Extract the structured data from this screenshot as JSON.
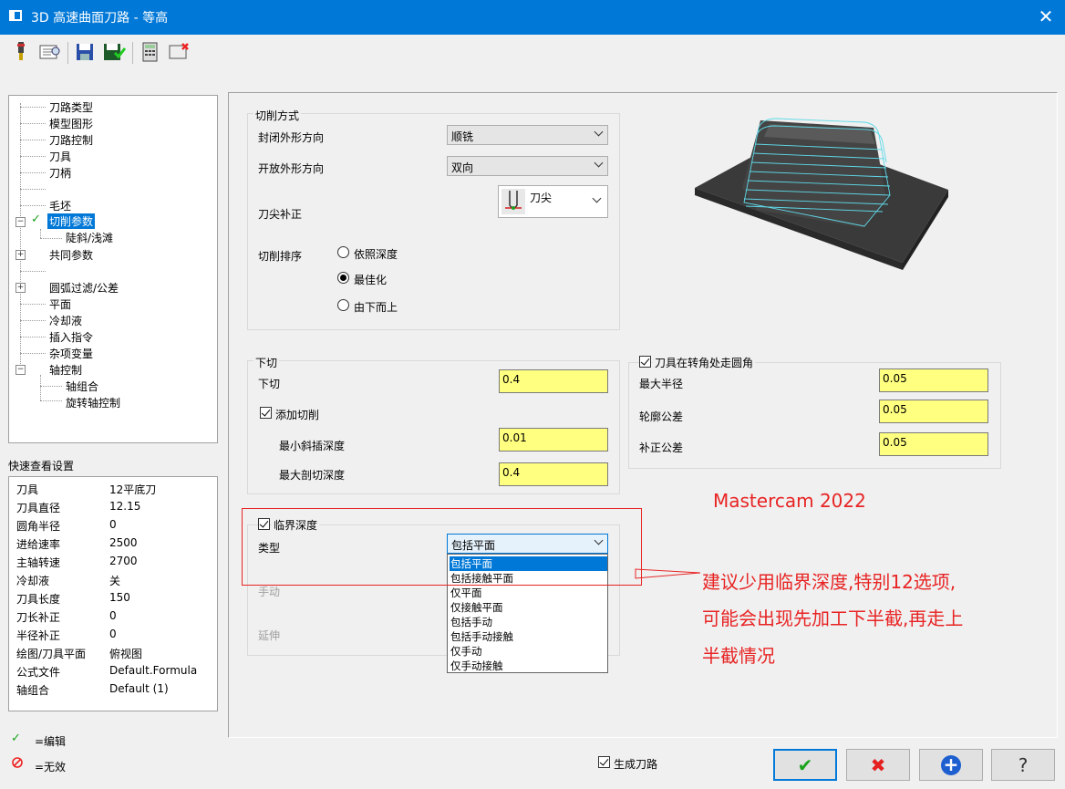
{
  "window": {
    "title": "3D 高速曲面刀路 - 等高",
    "close_glyph": "✕"
  },
  "toolbar": {
    "icons": [
      "tool-icon",
      "parameters-view-icon",
      "save-icon",
      "save-as-icon",
      "calculator-icon",
      "delete-icon"
    ]
  },
  "tree": {
    "items": [
      {
        "label": "刀路类型"
      },
      {
        "label": "模型图形"
      },
      {
        "label": "刀路控制"
      },
      {
        "label": "刀具"
      },
      {
        "label": "刀柄"
      },
      {
        "label": "毛坯"
      },
      {
        "label": "切削参数",
        "selected": true
      },
      {
        "label": "陡斜/浅滩"
      },
      {
        "label": "共同参数"
      },
      {
        "label": "圆弧过滤/公差"
      },
      {
        "label": "平面"
      },
      {
        "label": "冷却液"
      },
      {
        "label": "插入指令"
      },
      {
        "label": "杂项变量"
      },
      {
        "label": "轴控制"
      },
      {
        "label": "轴组合"
      },
      {
        "label": "旋转轴控制"
      }
    ]
  },
  "quickview": {
    "title": "快速查看设置",
    "rows": [
      {
        "k": "刀具",
        "v": "12平底刀"
      },
      {
        "k": "刀具直径",
        "v": "12.15"
      },
      {
        "k": "圆角半径",
        "v": "0"
      },
      {
        "k": "进给速率",
        "v": "2500"
      },
      {
        "k": "主轴转速",
        "v": "2700"
      },
      {
        "k": "冷却液",
        "v": "关"
      },
      {
        "k": "刀具长度",
        "v": "150"
      },
      {
        "k": "刀长补正",
        "v": "0"
      },
      {
        "k": "半径补正",
        "v": "0"
      },
      {
        "k": "绘图/刀具平面",
        "v": "俯视图"
      },
      {
        "k": "公式文件",
        "v": "Default.Formula"
      },
      {
        "k": "轴组合",
        "v": "Default (1)"
      }
    ]
  },
  "legend": {
    "edit": "=编辑",
    "invalid": "=无效"
  },
  "cut_method": {
    "title": "切削方式",
    "closed_label": "封闭外形方向",
    "closed_value": "顺铣",
    "open_label": "开放外形方向",
    "open_value": "双向",
    "comp_label": "刀尖补正",
    "comp_value": "刀尖",
    "order_label": "切削排序",
    "order_options": [
      "依照深度",
      "最佳化",
      "由下而上"
    ],
    "order_selected": 1
  },
  "stepdown": {
    "title": "下切",
    "stepdown_label": "下切",
    "stepdown_value": "0.4",
    "add_cuts_label": "添加切削",
    "add_cuts_checked": true,
    "min_ramp_label": "最小斜插深度",
    "min_ramp_value": "0.01",
    "max_cut_label": "最大剖切深度",
    "max_cut_value": "0.4"
  },
  "corner": {
    "title": "刀具在转角处走圆角",
    "checked": true,
    "max_radius_label": "最大半径",
    "max_radius_value": "0.05",
    "profile_tol_label": "轮廓公差",
    "profile_tol_value": "0.05",
    "offset_tol_label": "补正公差",
    "offset_tol_value": "0.05"
  },
  "critical": {
    "title": "临界深度",
    "checked": true,
    "type_label": "类型",
    "type_value": "包括平面",
    "manual_label": "手动",
    "extend_label": "延伸",
    "options": [
      "包括平面",
      "包括接触平面",
      "仅平面",
      "仅接触平面",
      "包括手动",
      "包括手动接触",
      "仅手动",
      "仅手动接触"
    ],
    "selected_index": 0
  },
  "footer": {
    "generate_label": "生成刀路",
    "generate_checked": true,
    "buttons": [
      {
        "name": "ok",
        "glyph": "✔",
        "color": "#1aa31a"
      },
      {
        "name": "cancel",
        "glyph": "✖",
        "color": "#e52020"
      },
      {
        "name": "add",
        "glyph": "+",
        "color": "#1e5fd0"
      },
      {
        "name": "help",
        "glyph": "?",
        "color": "#333333"
      }
    ]
  },
  "annotations": {
    "brand": "Mastercam 2022",
    "note_line1": "建议少用临界深度,特别12选项,",
    "note_line2": "可能会出现先加工下半截,再走上",
    "note_line3": "半截情况"
  },
  "colors": {
    "accent": "#0078d7",
    "annotation": "#e82424",
    "input_yellow": "#ffff80"
  }
}
